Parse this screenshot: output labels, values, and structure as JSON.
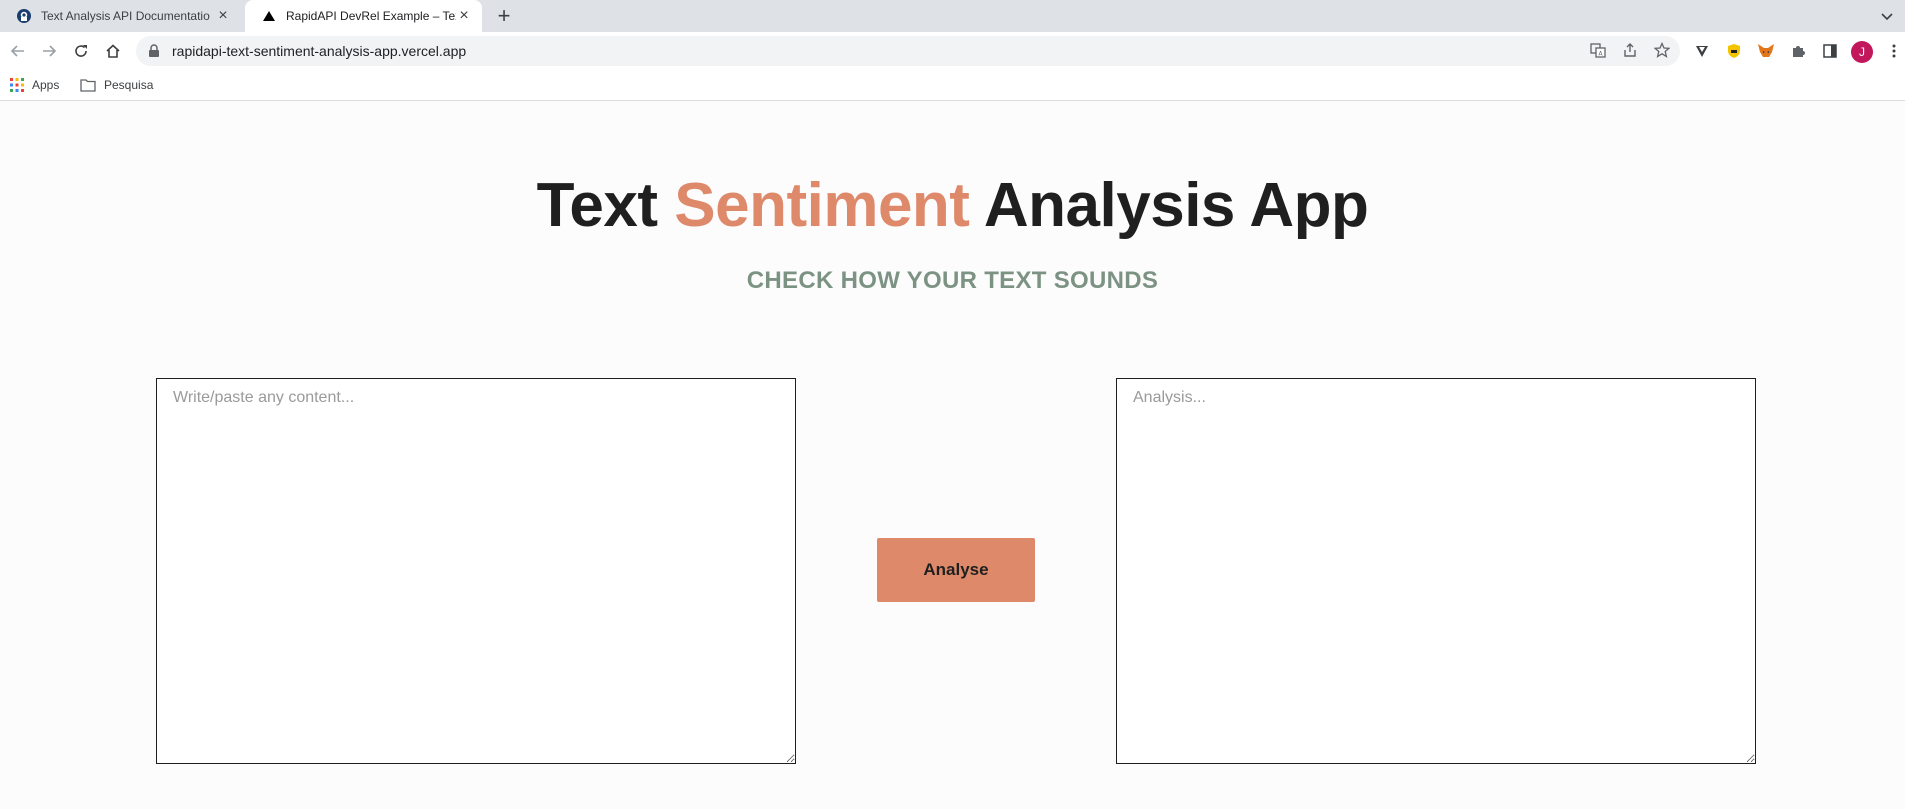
{
  "browser": {
    "tabs": [
      {
        "title": "Text Analysis API Documentatio",
        "active": false,
        "icon": "rapidapi-favicon-icon"
      },
      {
        "title": "RapidAPI DevRel Example – Tex",
        "active": true,
        "icon": "vercel-triangle-icon"
      }
    ],
    "url": "rapidapi-text-sentiment-analysis-app.vercel.app",
    "avatar_initial": "J",
    "bookmarks": [
      {
        "label": "Apps",
        "icon": "apps-grid-icon"
      },
      {
        "label": "Pesquisa",
        "icon": "folder-icon"
      }
    ]
  },
  "app": {
    "title_part1": "Text ",
    "title_accent": "Sentiment",
    "title_part2": " Analysis App",
    "subtitle": "CHECK HOW YOUR TEXT SOUNDS",
    "input_placeholder": "Write/paste any content...",
    "output_placeholder": "Analysis...",
    "analyse_label": "Analyse"
  },
  "colors": {
    "accent": "#de8a6a",
    "subtitle": "#7c9384",
    "title": "#1f1f1f",
    "background": "#fcfcfc"
  }
}
